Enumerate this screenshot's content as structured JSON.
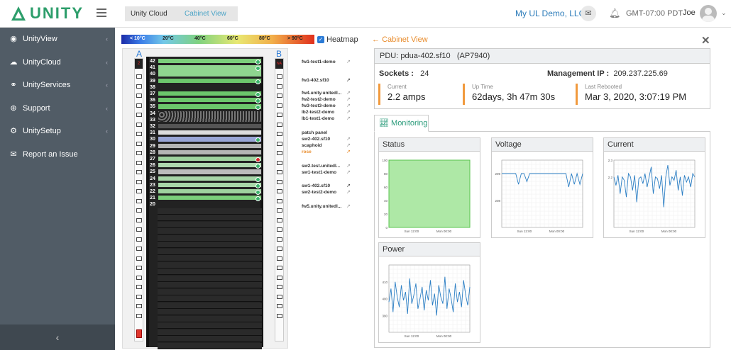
{
  "app": {
    "name": "UNITY"
  },
  "header": {
    "breadcrumbs": [
      "Unity Cloud",
      "Cabinet View"
    ],
    "org": "My UL Demo, LLC",
    "timezone": "GMT-07:00 PDT",
    "user": "Joe"
  },
  "sidebar": {
    "items": [
      {
        "label": "UnityView",
        "icon": "eye-icon"
      },
      {
        "label": "UnityCloud",
        "icon": "cloud-icon"
      },
      {
        "label": "UnityServices",
        "icon": "handshake-icon"
      },
      {
        "label": "Support",
        "icon": "lifebuoy-icon"
      },
      {
        "label": "UnitySetup",
        "icon": "cogs-icon"
      },
      {
        "label": "Report an Issue",
        "icon": "envelope-icon"
      }
    ]
  },
  "heatmap": {
    "legend": [
      "< 10°C",
      "20°C",
      "40°C",
      "60°C",
      "80°C",
      "> 90°C"
    ],
    "label": "Heatmap",
    "checked": true
  },
  "rack": {
    "side_a": "A",
    "side_b": "B",
    "pdu_a_tag": "2",
    "pdu_b_tag": "NA",
    "units": [
      "42",
      "41",
      "40",
      "39",
      "38",
      "37",
      "36",
      "35",
      "34",
      "33",
      "32",
      "31",
      "30",
      "29",
      "28",
      "27",
      "26",
      "25",
      "24",
      "23",
      "22",
      "21",
      "20"
    ],
    "devices": [
      "fw1-test1-demo",
      "fw1-402.sf10",
      "fw4.unity.unitedl...",
      "fw2-test2-demo",
      "fw3-test3-demo",
      "lb2-test2-demo",
      "lb1-test1-demo",
      "patch panel",
      "sw2-402.sf10",
      "scaphoid",
      "rose",
      "sw2.test.unitedl...",
      "sw1-test1-demo",
      "sw1-402.sf10",
      "sw2-test2-demo",
      "fw5.unity.unitedl..."
    ],
    "highlight_device": "rose"
  },
  "detail": {
    "back_label": "Cabinet View",
    "pdu_title": "PDU: pdua-402.sf10",
    "pdu_model": "(AP7940)",
    "sockets_label": "Sockets :",
    "sockets": "24",
    "mgmt_label": "Management IP :",
    "mgmt_ip": "209.237.225.69",
    "stats": [
      {
        "label": "Current",
        "value": "2.2 amps"
      },
      {
        "label": "Up Time",
        "value": "62days, 3h 47m 30s"
      },
      {
        "label": "Last Rebooted",
        "value": "Mar 3, 2020, 3:07:19 PM"
      }
    ],
    "tab": "Monitoring"
  },
  "charts_text": {
    "status": {
      "title": "Status"
    },
    "voltage": {
      "title": "Voltage"
    },
    "current": {
      "title": "Current"
    },
    "power": {
      "title": "Power"
    }
  },
  "chart_data": [
    {
      "type": "area",
      "title": "Status",
      "x": [
        "Sun 12:00",
        "Mon 00:00"
      ],
      "ylim": [
        0,
        100
      ],
      "yticks": [
        0,
        20,
        40,
        60,
        80,
        100
      ],
      "values": [
        100,
        100,
        100,
        100,
        100,
        100,
        100,
        100
      ]
    },
    {
      "type": "line",
      "title": "Voltage",
      "x": [
        "Sun 12:00",
        "Mon 00:00"
      ],
      "ylim": [
        207,
        209.5
      ],
      "yticks": [
        208,
        209
      ],
      "values": [
        209,
        209,
        209,
        209,
        209,
        209,
        208.6,
        209,
        209,
        208.7,
        209,
        209,
        209,
        209,
        209,
        209,
        209,
        209,
        209,
        209,
        209,
        209,
        209,
        209,
        208.5,
        209,
        208.6,
        209,
        208.6,
        209
      ]
    },
    {
      "type": "line",
      "title": "Current",
      "x": [
        "Sun 12:00",
        "Mon 00:00"
      ],
      "ylim": [
        1.9,
        2.3
      ],
      "yticks": [
        2.2,
        2.3
      ],
      "values": [
        2.2,
        2.15,
        2.21,
        2.1,
        2.2,
        2.18,
        2.08,
        2.22,
        2.2,
        2.12,
        2.21,
        2.05,
        2.19,
        2.2,
        2.16,
        2.22,
        2.14,
        2.2,
        2.26,
        2.1,
        2.2,
        2.19,
        2.13,
        2.21,
        2.02,
        2.2,
        2.27,
        2.15,
        2.2,
        2.18,
        2.24,
        2.12,
        2.2,
        2.09,
        2.21,
        2.17,
        2.2,
        2.14,
        2.22,
        2.2
      ]
    },
    {
      "type": "line",
      "title": "Power",
      "x": [
        "Sun 12:00",
        "Mon 00:00"
      ],
      "ylim": [
        380,
        420
      ],
      "yticks": [
        390,
        400,
        410
      ],
      "values": [
        398,
        406,
        392,
        410,
        401,
        395,
        408,
        399,
        404,
        391,
        412,
        397,
        402,
        409,
        394,
        400,
        407,
        393,
        405,
        399,
        411,
        396,
        403,
        390,
        408,
        401,
        397,
        413,
        394,
        406,
        400,
        392,
        409,
        398,
        404,
        395,
        411,
        402,
        396,
        407
      ]
    }
  ]
}
